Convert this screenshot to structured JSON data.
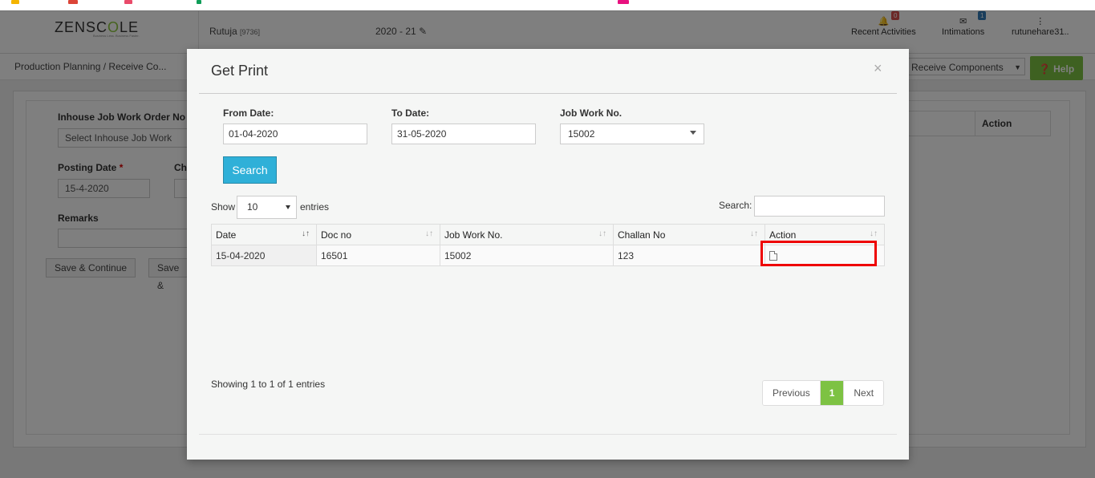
{
  "app": {
    "logo": "ZENSCALE",
    "logo_tagline": "Business Less. Business Faster.",
    "user": "Rutuja",
    "user_id": "[9736]",
    "fiscal_year": "2020 - 21",
    "recent_activities": {
      "label": "Recent Activities",
      "count": "0"
    },
    "intimations": {
      "label": "Intimations",
      "count": "1"
    },
    "account": "rutunehare31.."
  },
  "breadcrumb": {
    "text": "Production Planning  / Receive Co..."
  },
  "page_select": {
    "value": "Receive Components"
  },
  "help": {
    "label": "Help"
  },
  "form": {
    "inhouse_label": "Inhouse Job Work Order No",
    "inhouse_placeholder": "Select Inhouse Job Work",
    "posting_date_label": "Posting Date",
    "posting_date_value": "15-4-2020",
    "challan_label": "Cha",
    "remarks_label": "Remarks",
    "save_continue": "Save & Continue",
    "save_other": "Save &",
    "table_action_header": "Action"
  },
  "modal": {
    "title": "Get Print",
    "close": "×",
    "from_date_label": "From Date:",
    "from_date_value": "01-04-2020",
    "to_date_label": "To Date:",
    "to_date_value": "31-05-2020",
    "job_work_label": "Job Work No.",
    "job_work_value": "15002",
    "search_button": "Search",
    "show_label": "Show",
    "entries_value": "10",
    "entries_label": "entries",
    "search_label": "Search:",
    "columns": [
      "Date",
      "Doc no",
      "Job Work No.",
      "Challan No",
      "Action"
    ],
    "rows": [
      {
        "date": "15-04-2020",
        "doc_no": "16501",
        "job_work_no": "15002",
        "challan_no": "123",
        "action_icon": "pdf-icon"
      }
    ],
    "info": "Showing 1 to 1 of 1 entries",
    "pagination": {
      "previous": "Previous",
      "current": "1",
      "next": "Next"
    }
  },
  "colors": {
    "accent_green": "#7dc243",
    "search_blue": "#2fb0d8",
    "highlight_red": "#e00000",
    "badge_red": "#d9534f",
    "badge_blue": "#337ab7"
  }
}
